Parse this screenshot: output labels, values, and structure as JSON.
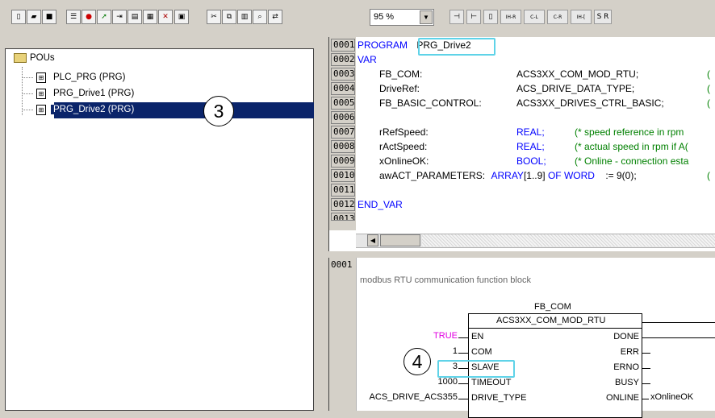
{
  "toolbar": {
    "buttons_left": [
      "new-icon",
      "open-icon",
      "save-icon",
      "insert-icon",
      "stop-icon",
      "run-icon",
      "step-icon",
      "print-icon",
      "compile-icon",
      "export-icon"
    ],
    "buttons_mid": [
      "cut-icon",
      "copy-icon",
      "paste-icon",
      "find-icon",
      "replace-icon"
    ],
    "zoom_value": "95 %",
    "fbd_buttons": [
      "IH-R",
      "C-L",
      "C-R",
      "IH-[",
      "S R"
    ]
  },
  "tree": {
    "root_label": "POUs",
    "items": [
      {
        "label": "PLC_PRG (PRG)",
        "selected": false
      },
      {
        "label": "PRG_Drive1 (PRG)",
        "selected": false
      },
      {
        "label": "PRG_Drive2 (PRG)",
        "selected": true
      }
    ]
  },
  "callouts": {
    "tree_step": "3",
    "slave_step": "4"
  },
  "declaration": {
    "line_numbers": [
      "0001",
      "0002",
      "0003",
      "0004",
      "0005",
      "0006",
      "0007",
      "0008",
      "0009",
      "0010",
      "0011",
      "0012",
      "0013"
    ],
    "program_keyword": "PROGRAM",
    "program_name": "PRG_Drive2",
    "var_keyword": "VAR",
    "vars": [
      {
        "name": "FB_COM:",
        "type": "ACS3XX_COM_MOD_RTU;",
        "tail": "("
      },
      {
        "name": "DriveRef:",
        "type": "ACS_DRIVE_DATA_TYPE;",
        "tail": "("
      },
      {
        "name": "FB_BASIC_CONTROL:",
        "type": "ACS3XX_DRIVES_CTRL_BASIC;",
        "tail": "("
      }
    ],
    "vars2": [
      {
        "name": "rRefSpeed:",
        "type": "REAL;",
        "comment": "(* speed reference in rpm"
      },
      {
        "name": "rActSpeed:",
        "type": "REAL;",
        "comment": "(* actual speed in rpm if A("
      },
      {
        "name": "xOnlineOK:",
        "type": "BOOL;",
        "comment": "(* Online - connection esta"
      }
    ],
    "array_var": {
      "name": "awACT_PARAMETERS:",
      "type_pre": "ARRAY",
      "range": "[1..9]",
      "of": "OF",
      "word": "WORD",
      "init": ":= 9(0);",
      "tail": "("
    },
    "end_var": "END_VAR"
  },
  "fbd": {
    "line_number": "0001",
    "comment": "modbus RTU communication function block",
    "instance_name": "FB_COM",
    "block_type": "ACS3XX_COM_MOD_RTU",
    "inputs": [
      {
        "value": "TRUE",
        "pin": "EN"
      },
      {
        "value": "1",
        "pin": "COM"
      },
      {
        "value": "3",
        "pin": "SLAVE"
      },
      {
        "value": "1000",
        "pin": "TIMEOUT"
      },
      {
        "value": "ACS_DRIVE_ACS355",
        "pin": "DRIVE_TYPE"
      }
    ],
    "outputs": [
      {
        "pin": "DONE",
        "value": ""
      },
      {
        "pin": "ERR",
        "value": ""
      },
      {
        "pin": "ERNO",
        "value": ""
      },
      {
        "pin": "BUSY",
        "value": ""
      },
      {
        "pin": "ONLINE",
        "value": "xOnlineOK"
      }
    ]
  },
  "colors": {
    "highlight": "#5fd3e8",
    "selection": "#0a246a",
    "keyword": "#0000ff",
    "comment": "#008000",
    "true_literal": "#e000e0"
  }
}
